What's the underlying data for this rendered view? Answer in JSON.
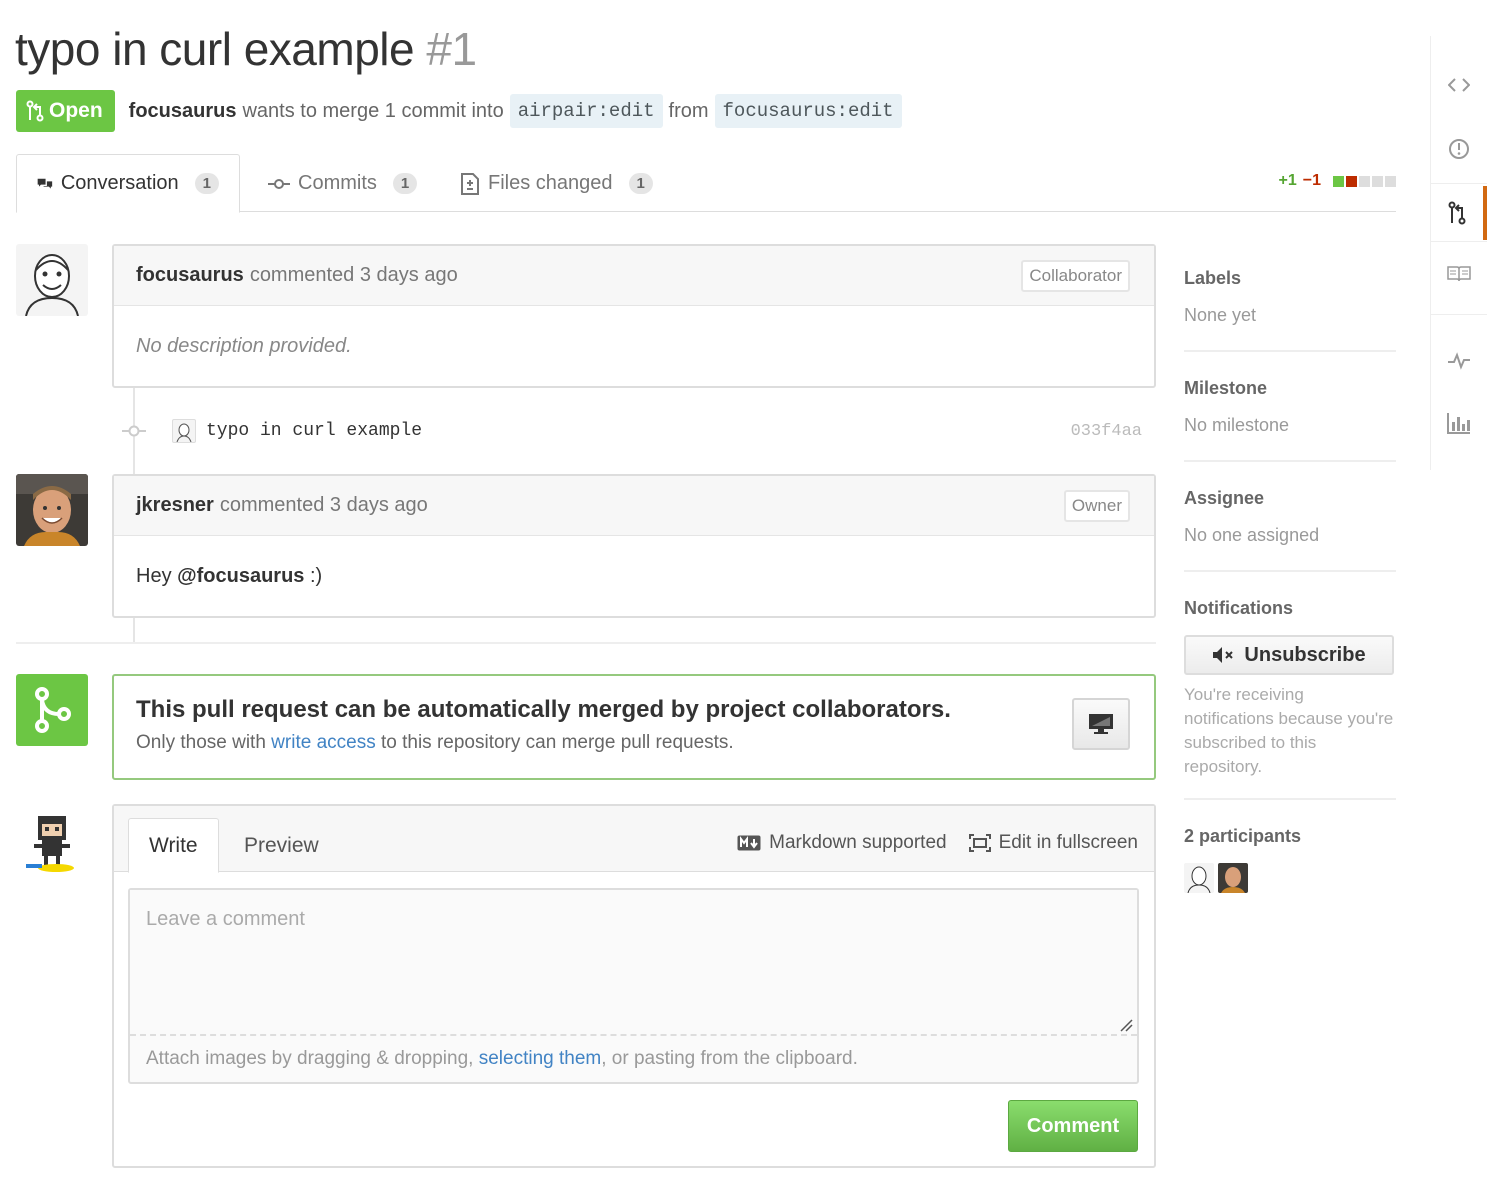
{
  "header": {
    "title": "typo in curl example",
    "number": "#1",
    "state_label": "Open",
    "author": "focusaurus",
    "merge_text": "wants to merge 1 commit into",
    "base_branch": "airpair:edit",
    "from_text": "from",
    "head_branch": "focusaurus:edit"
  },
  "tabs": [
    {
      "label": "Conversation",
      "count": "1"
    },
    {
      "label": "Commits",
      "count": "1"
    },
    {
      "label": "Files changed",
      "count": "1"
    }
  ],
  "diffstat": {
    "additions": "+1",
    "deletions": "−1",
    "colors": [
      "#6cc644",
      "#bd2c00",
      "#dddddd",
      "#dddddd",
      "#dddddd"
    ]
  },
  "comments": [
    {
      "author": "focusaurus",
      "action": "commented 3 days ago",
      "role": "Collaborator",
      "body": "No description provided."
    },
    {
      "author": "jkresner",
      "action": "commented 3 days ago",
      "role": "Owner",
      "body_prefix": "Hey ",
      "mention": "@focusaurus",
      "body_suffix": " :)"
    }
  ],
  "commit": {
    "message": "typo in curl example",
    "sha": "033f4aa"
  },
  "merge": {
    "title": "This pull request can be automatically merged by project collaborators.",
    "sub_prefix": "Only those with ",
    "sub_link": "write access",
    "sub_suffix": " to this repository can merge pull requests."
  },
  "new_comment": {
    "write_tab": "Write",
    "preview_tab": "Preview",
    "markdown_label": "Markdown supported",
    "fullscreen_label": "Edit in fullscreen",
    "placeholder": "Leave a comment",
    "attach_prefix": "Attach images by dragging & dropping, ",
    "attach_link": "selecting them",
    "attach_suffix": ", or pasting from the clipboard.",
    "submit_label": "Comment"
  },
  "sidebar": {
    "labels_title": "Labels",
    "labels_value": "None yet",
    "milestone_title": "Milestone",
    "milestone_value": "No milestone",
    "assignee_title": "Assignee",
    "assignee_value": "No one assigned",
    "notifications_title": "Notifications",
    "unsubscribe_label": "Unsubscribe",
    "notifications_reason": "You're receiving notifications because you're subscribed to this repository.",
    "participants_title": "2 participants"
  },
  "repo_nav": [
    "code-icon",
    "issue-icon",
    "pull-request-icon",
    "wiki-icon",
    "pulse-icon",
    "graphs-icon"
  ]
}
